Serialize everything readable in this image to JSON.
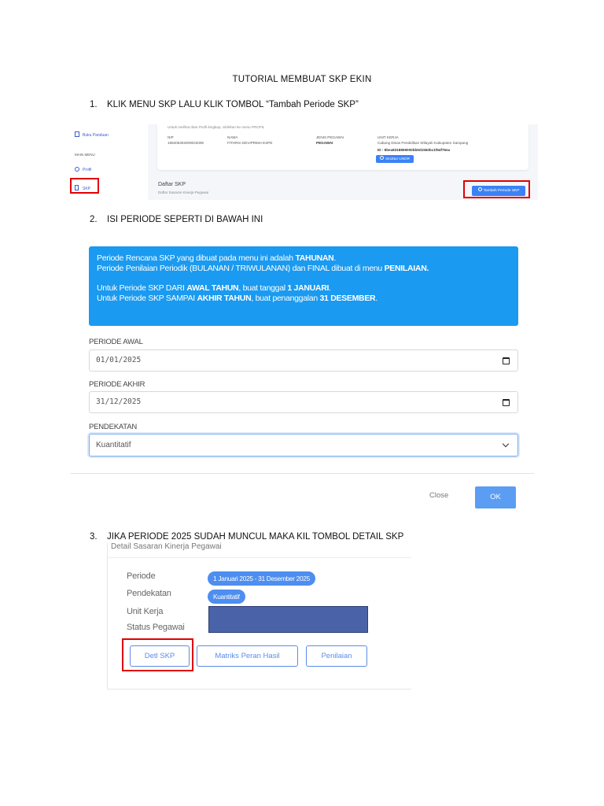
{
  "doc_title": "TUTORIAL MEMBUAT SKP EKIN",
  "steps": [
    {
      "num": "1.",
      "text": "KLIK MENU SKP LALU KLIK TOMBOL “Tambah Periode SKP”"
    },
    {
      "num": "2.",
      "text": "ISI PERIODE SEPERTI DI BAWAH INI"
    },
    {
      "num": "3.",
      "text": "JIKA PERIODE 2025 SUDAH MUNCUL MAKA KIL TOMBOL DETAIL SKP"
    }
  ],
  "shot1": {
    "sidebar": {
      "buku_panduan": "Buku Panduan",
      "main_menu": "MAIN MENU",
      "profil": "Profil",
      "skp": "SKP"
    },
    "profile_hint": "Untuk melihat data Profil lengkap, silahkan ke menu PROFIL",
    "nip_label": "NIP",
    "nip_value": "198406302009022006",
    "nama_label": "NAMA",
    "nama_value": "FITHRIA DEVIPRIMA ESPE",
    "jenis_label": "JENIS PEGAWAI",
    "jenis_value": "PEGAWAI",
    "unit_label": "UNIT KERJA",
    "unit_value": "Cabang Dinas Pendidikan Wilayah Kabupaten Sampang",
    "unit_id": "ID : 8bea8318859000bb9d1550bc1f64f76ea",
    "unor_button": "Struktur UNOR",
    "daftar_title": "Daftar SKP",
    "daftar_sub": "Daftar Sasaran Kinerja Pegawai",
    "tambah_button": "Tambah Periode SKP"
  },
  "shot2": {
    "info_lines": [
      [
        {
          "t": "Periode Rencana SKP yang dibuat pada menu ini adalah "
        },
        {
          "t": "TAHUNAN",
          "b": true
        },
        {
          "t": "."
        }
      ],
      [
        {
          "t": "Periode Penilaian Periodik (BULANAN / TRIWULANAN) dan FINAL dibuat di menu "
        },
        {
          "t": "PENILAIAN.",
          "b": true
        }
      ],
      [
        {
          "t": "Untuk Periode SKP DARI "
        },
        {
          "t": "AWAL TAHUN",
          "b": true
        },
        {
          "t": ", buat tanggal "
        },
        {
          "t": "1 JANUARI",
          "b": true
        },
        {
          "t": "."
        }
      ],
      [
        {
          "t": "Untuk Periode SKP SAMPAI "
        },
        {
          "t": "AKHIR TAHUN",
          "b": true
        },
        {
          "t": ", buat penanggalan "
        },
        {
          "t": "31 DESEMBER",
          "b": true
        },
        {
          "t": "."
        }
      ]
    ],
    "periode_awal_label": "PERIODE AWAL",
    "periode_awal_value": "01/01/2025",
    "periode_akhir_label": "PERIODE AKHIR",
    "periode_akhir_value": "31/12/2025",
    "pendekatan_label": "PENDEKATAN",
    "pendekatan_value": "Kuantitatif",
    "close_button": "Close",
    "ok_button": "OK"
  },
  "shot3": {
    "partial_title": "Detail Sasaran Kinerja Pegawai",
    "periode_label": "Periode",
    "periode_value": "1 Januari 2025 - 31 Desember 2025",
    "pendekatan_label": "Pendekatan",
    "pendekatan_value": "Kuantitatif",
    "unit_label": "Unit Kerja",
    "status_label": "Status Pegawai",
    "btn_detail": "Detl SKP",
    "btn_matriks": "Matriks Peran Hasil",
    "btn_penilaian": "Penilaian"
  },
  "colors": {
    "accent": "#1a9af0",
    "button": "#5b9df3",
    "highlight": "#e00000",
    "redact": "#4a63a8"
  }
}
